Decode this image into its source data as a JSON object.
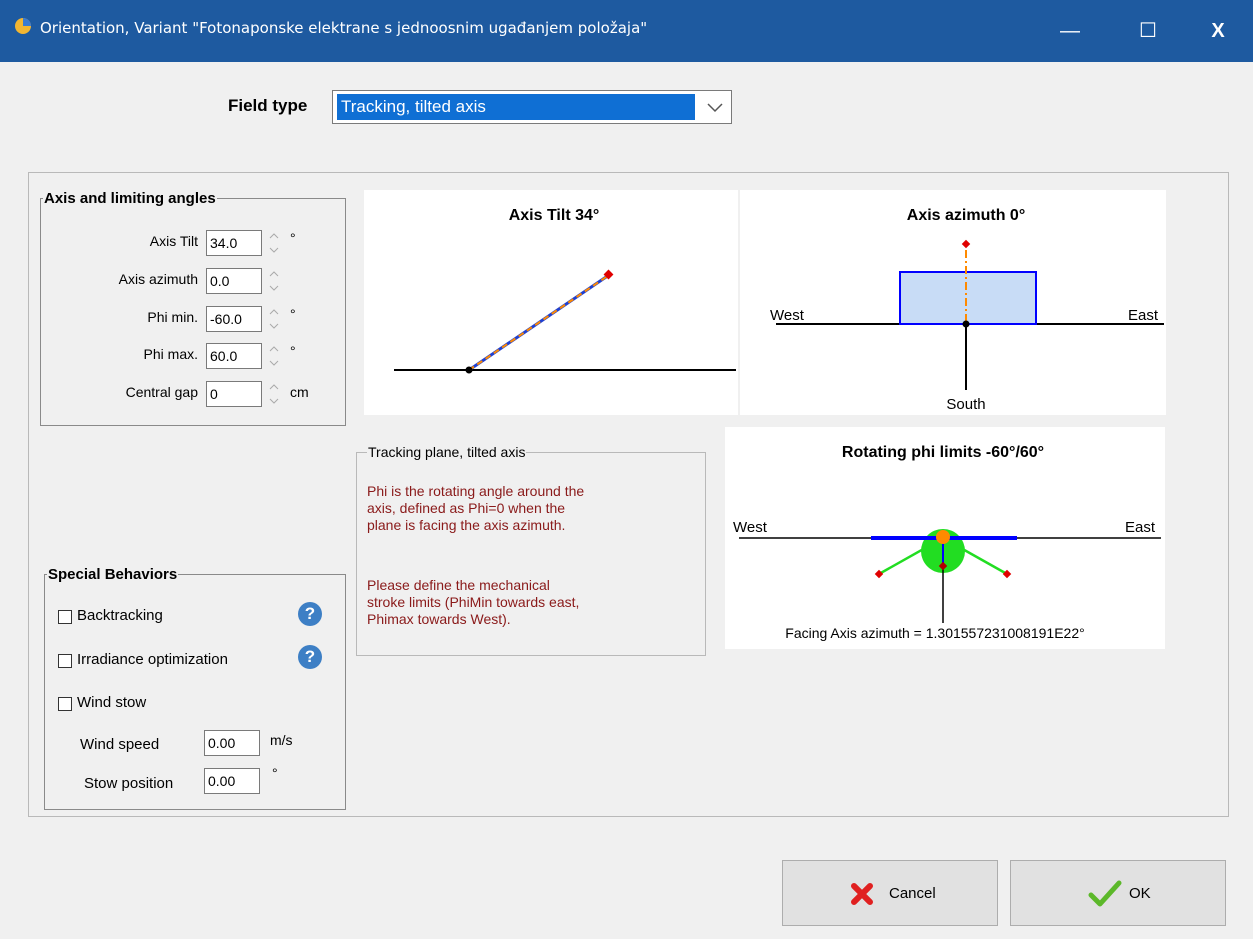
{
  "window": {
    "title": "Orientation, Variant \"Fotonaponske elektrane s jednoosnim ugađanjem položaja\"",
    "minimize_glyph": "—",
    "maximize_glyph": "☐",
    "close_glyph": "X"
  },
  "field_type": {
    "label": "Field type",
    "value": "Tracking, tilted axis"
  },
  "axis_group": {
    "title": "Axis and limiting angles",
    "rows": [
      {
        "label": "Axis Tilt",
        "value": "34.0",
        "unit": "°"
      },
      {
        "label": "Axis azimuth",
        "value": "0.0",
        "unit": ""
      },
      {
        "label": "Phi min.",
        "value": "-60.0",
        "unit": "°"
      },
      {
        "label": "Phi max.",
        "value": "60.0",
        "unit": "°"
      },
      {
        "label": "Central gap",
        "value": "0",
        "unit": "cm"
      }
    ]
  },
  "special_group": {
    "title": "Special Behaviors",
    "backtracking": "Backtracking",
    "irradiance": "Irradiance optimization",
    "wind_stow": "Wind stow",
    "wind_speed_label": "Wind speed",
    "wind_speed_value": "0.00",
    "wind_speed_unit": "m/s",
    "stow_position_label": "Stow position",
    "stow_position_value": "0.00",
    "stow_position_unit": "°",
    "help_glyph": "?"
  },
  "diagram_tilt": {
    "title": "Axis Tilt 34°"
  },
  "diagram_azimuth": {
    "title": "Axis azimuth 0°",
    "west": "West",
    "east": "East",
    "south": "South"
  },
  "diagram_phi": {
    "title": "Rotating phi limits -60°/60°",
    "west": "West",
    "east": "East",
    "facing": "Facing Axis azimuth = 1.301557231008191E22°"
  },
  "info": {
    "heading": "Tracking plane, tilted axis",
    "para1_lines": [
      "Phi is the rotating angle around the",
      "axis, defined as Phi=0 when the",
      "plane is facing the axis azimuth."
    ],
    "para2_lines": [
      "Please define the mechanical",
      "stroke limits (PhiMin towards east,",
      "Phimax towards West)."
    ]
  },
  "buttons": {
    "cancel": "Cancel",
    "ok": "OK"
  },
  "colors": {
    "titlebar": "#1e5aa0",
    "selection": "#0f6fd4",
    "info_text": "#8a1a1a",
    "tracker_blue": "#0000ff",
    "stroke_green": "#22dd22",
    "marker_red": "#e00000",
    "axis_orange": "#ff8a00"
  }
}
